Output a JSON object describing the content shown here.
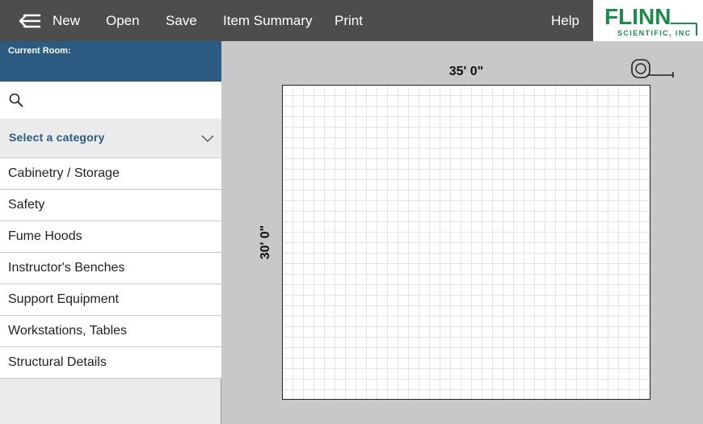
{
  "toolbar": {
    "menu_icon": "menu-back-icon",
    "items": [
      "New",
      "Open",
      "Save",
      "Item Summary",
      "Print"
    ],
    "help": "Help"
  },
  "logo": {
    "line1": "FLINN",
    "line2": "SCIENTIFIC, INC",
    "color": "#1e8a4c"
  },
  "sidebar": {
    "current_room_label": "Current Room:",
    "current_room_value": "",
    "search": {
      "placeholder": "",
      "value": ""
    },
    "category_select": "Select a category",
    "categories": [
      "Cabinetry / Storage",
      "Safety",
      "Fume Hoods",
      "Instructor's Benches",
      "Support Equipment",
      "Workstations, Tables",
      "Structural Details"
    ]
  },
  "room": {
    "width_label": "35' 0\"",
    "height_label": "30' 0\""
  },
  "colors": {
    "topbar": "#4d4d4d",
    "room_header": "#2b5b80",
    "accent_text": "#2b5b80",
    "canvas_bg": "#c8c8c8"
  }
}
